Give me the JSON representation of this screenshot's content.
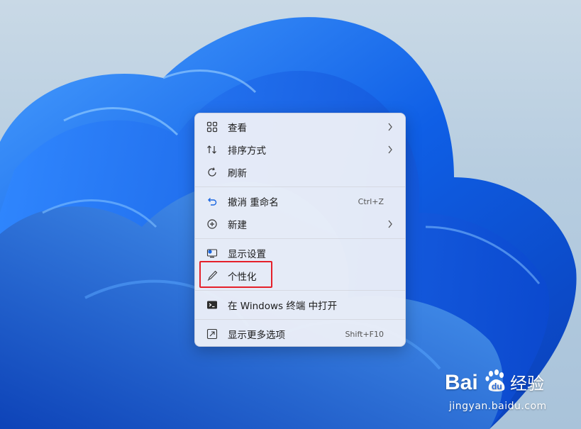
{
  "menu": {
    "items": [
      {
        "label": "查看",
        "icon": "view-grid-icon",
        "has_submenu": true
      },
      {
        "label": "排序方式",
        "icon": "sort-icon",
        "has_submenu": true
      },
      {
        "label": "刷新",
        "icon": "refresh-icon",
        "has_submenu": false
      },
      {
        "label": "撤消 重命名",
        "icon": "undo-icon",
        "shortcut": "Ctrl+Z"
      },
      {
        "label": "新建",
        "icon": "new-plus-icon",
        "has_submenu": true
      },
      {
        "label": "显示设置",
        "icon": "display-settings-icon"
      },
      {
        "label": "个性化",
        "icon": "brush-icon",
        "highlighted": true
      },
      {
        "label": "在 Windows 终端 中打开",
        "icon": "terminal-icon"
      },
      {
        "label": "显示更多选项",
        "icon": "more-options-icon",
        "shortcut": "Shift+F10"
      }
    ]
  },
  "highlight_color": "#e5202a",
  "accent_color": "#1a66e0",
  "watermark": {
    "subtitle": "jingyan.baidu.com"
  }
}
